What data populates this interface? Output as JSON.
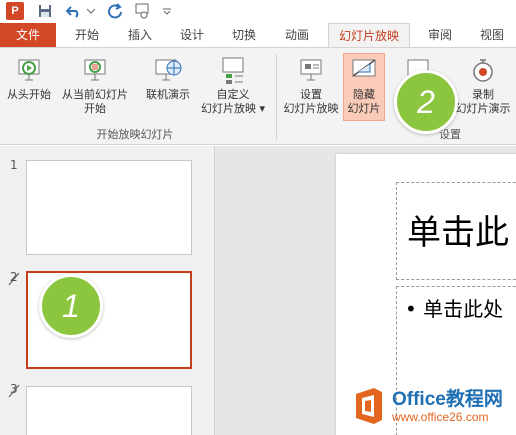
{
  "qat": {
    "logo_text": "P",
    "icons": [
      "powerpoint-logo-icon",
      "save-icon",
      "undo-icon",
      "redo-icon",
      "touch-mode-icon",
      "customize-qat-icon"
    ]
  },
  "tabs": [
    "文件",
    "开始",
    "插入",
    "设计",
    "切换",
    "动画",
    "幻灯片放映",
    "审阅",
    "视图"
  ],
  "active_tab": "幻灯片放映",
  "ribbon": {
    "from_beginning": "从头开始",
    "from_current_line1": "从当前幻灯片",
    "from_current_line2": "开始",
    "present_online": "联机演示",
    "custom_show_line1": "自定义",
    "custom_show_line2": "幻灯片放映",
    "group1_label": "开始放映幻灯片",
    "setup_line1": "设置",
    "setup_line2": "幻灯片放映",
    "hide_line1": "隐藏",
    "hide_line2": "幻灯片",
    "record_line1": "录制",
    "record_line2": "幻灯片演示",
    "group2_label": "设置"
  },
  "slides": [
    {
      "num": "1"
    },
    {
      "num": "2"
    },
    {
      "num": "3"
    }
  ],
  "canvas": {
    "title_text": "单击此",
    "body_text": "• 单击此处"
  },
  "badges": {
    "one": "1",
    "two": "2"
  },
  "watermark": {
    "title": "Office教程网",
    "sub": "www.office26.com"
  },
  "colors": {
    "accent": "#d24726",
    "active_tab_text": "#c43e1c",
    "badge_green": "#8cc63e",
    "highlight": "#f9cbb8"
  }
}
